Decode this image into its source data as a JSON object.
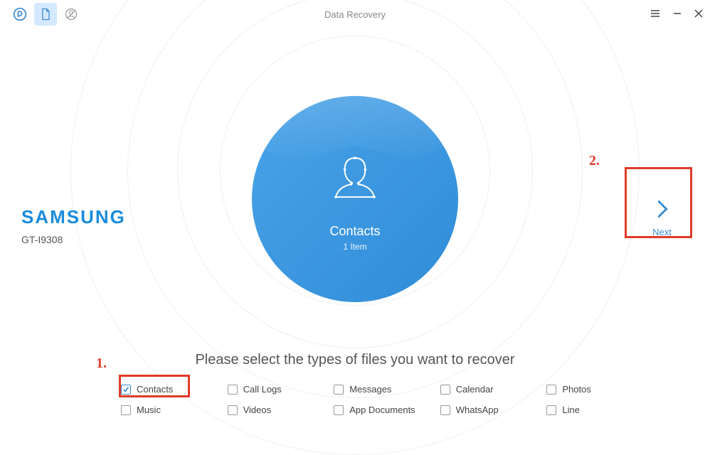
{
  "window": {
    "title": "Data Recovery"
  },
  "device": {
    "brand": "SAMSUNG",
    "model": "GT-I9308"
  },
  "center": {
    "category": "Contacts",
    "count_label": "1 Item"
  },
  "next": {
    "label": "Next"
  },
  "instruction": "Please select the types of files you want to recover",
  "annotations": {
    "one": "1.",
    "two": "2."
  },
  "fileTypes": {
    "row1": [
      {
        "label": "Contacts",
        "checked": true
      },
      {
        "label": "Call Logs",
        "checked": false
      },
      {
        "label": "Messages",
        "checked": false
      },
      {
        "label": "Calendar",
        "checked": false
      },
      {
        "label": "Photos",
        "checked": false
      }
    ],
    "row2": [
      {
        "label": "Music",
        "checked": false
      },
      {
        "label": "Videos",
        "checked": false
      },
      {
        "label": "App Documents",
        "checked": false
      },
      {
        "label": "WhatsApp",
        "checked": false
      },
      {
        "label": "Line",
        "checked": false
      }
    ]
  }
}
